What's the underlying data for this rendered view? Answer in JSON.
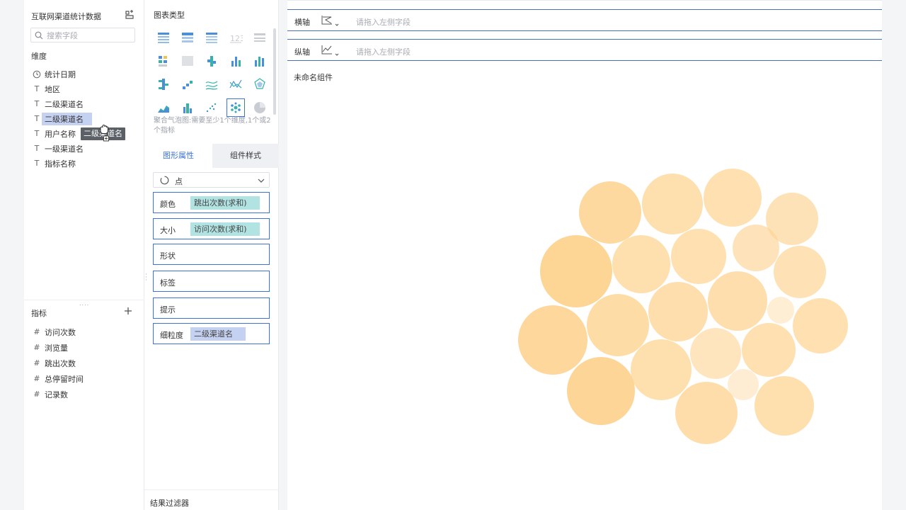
{
  "dataset": {
    "title": "互联网渠道统计数据",
    "search_placeholder": "搜索字段"
  },
  "dimensions": {
    "label": "维度",
    "items": [
      {
        "label": "统计日期",
        "icon": "clock-icon"
      },
      {
        "label": "地区",
        "icon": "text-field-icon"
      },
      {
        "label": "二级渠道名",
        "icon": "text-field-icon"
      },
      {
        "label": "二级渠道名",
        "icon": "text-field-icon",
        "selected": true
      },
      {
        "label": "用户名称",
        "icon": "text-field-icon"
      },
      {
        "label": "一级渠道名",
        "icon": "text-field-icon"
      },
      {
        "label": "指标名称",
        "icon": "text-field-icon"
      }
    ]
  },
  "metrics": {
    "label": "指标",
    "items": [
      {
        "label": "访问次数"
      },
      {
        "label": "浏览量"
      },
      {
        "label": "跳出次数"
      },
      {
        "label": "总停留时间"
      },
      {
        "label": "记录数"
      }
    ]
  },
  "drag_ghost": {
    "label": "二级渠道名"
  },
  "chart_types": {
    "title": "图表类型",
    "hint": "聚合气泡图:需要至少1个维度,1个或2个指标",
    "icons": [
      "grouped-table-icon",
      "detail-table-icon",
      "cross-table-icon",
      "kpi-number-icon",
      "disabled-table-icon",
      "heatmap-table-icon",
      "disabled-map-icon",
      "stacked-column-icon",
      "column-chart-icon",
      "multi-column-icon",
      "stacked-bar-icon",
      "waterfall-icon",
      "stream-line-icon",
      "line-chart-icon",
      "radar-icon",
      "area-chart-icon",
      "stacked-area-icon",
      "scatter-chart-icon",
      "bubble-chart-icon",
      "pie-chart-icon"
    ],
    "active_index": 18
  },
  "tabs": {
    "graph_props": "图形属性",
    "component_style": "组件样式"
  },
  "shape_select": {
    "value": "点"
  },
  "properties": {
    "color": {
      "label": "颜色",
      "field": "跳出次数(求和)"
    },
    "size": {
      "label": "大小",
      "field": "访问次数(求和)"
    },
    "shape": {
      "label": "形状"
    },
    "tag": {
      "label": "标签"
    },
    "tooltip": {
      "label": "提示"
    },
    "granularity": {
      "label": "细粒度",
      "field": "二级渠道名"
    }
  },
  "result_filter": {
    "label": "结果过滤器"
  },
  "axes": {
    "x": {
      "label": "横轴",
      "hint": "请拖入左侧字段"
    },
    "y": {
      "label": "纵轴",
      "hint": "请拖入左侧字段"
    }
  },
  "component": {
    "name": "未命名组件"
  },
  "colors": {
    "accent": "#3d72d6",
    "bubble_base": "#fdd28e",
    "pill_teal": "#b2e3e3",
    "pill_blue": "#c5d1f0"
  },
  "bubbles": [
    {
      "r": 44,
      "v": 0.8
    },
    {
      "r": 43,
      "v": 0.62
    },
    {
      "r": 41,
      "v": 0.58
    },
    {
      "r": 37,
      "v": 0.52
    },
    {
      "r": 51,
      "v": 0.92
    },
    {
      "r": 41,
      "v": 0.62
    },
    {
      "r": 39,
      "v": 0.58
    },
    {
      "r": 33,
      "v": 0.48
    },
    {
      "r": 37,
      "v": 0.55
    },
    {
      "r": 49,
      "v": 0.85
    },
    {
      "r": 44,
      "v": 0.72
    },
    {
      "r": 42,
      "v": 0.65
    },
    {
      "r": 42,
      "v": 0.64
    },
    {
      "r": 19,
      "v": 0.18
    },
    {
      "r": 39,
      "v": 0.58
    },
    {
      "r": 48,
      "v": 0.9
    },
    {
      "r": 43,
      "v": 0.62
    },
    {
      "r": 36,
      "v": 0.45
    },
    {
      "r": 38,
      "v": 0.58
    },
    {
      "r": 22,
      "v": 0.2
    },
    {
      "r": 44,
      "v": 0.66
    },
    {
      "r": 42,
      "v": 0.62
    }
  ]
}
